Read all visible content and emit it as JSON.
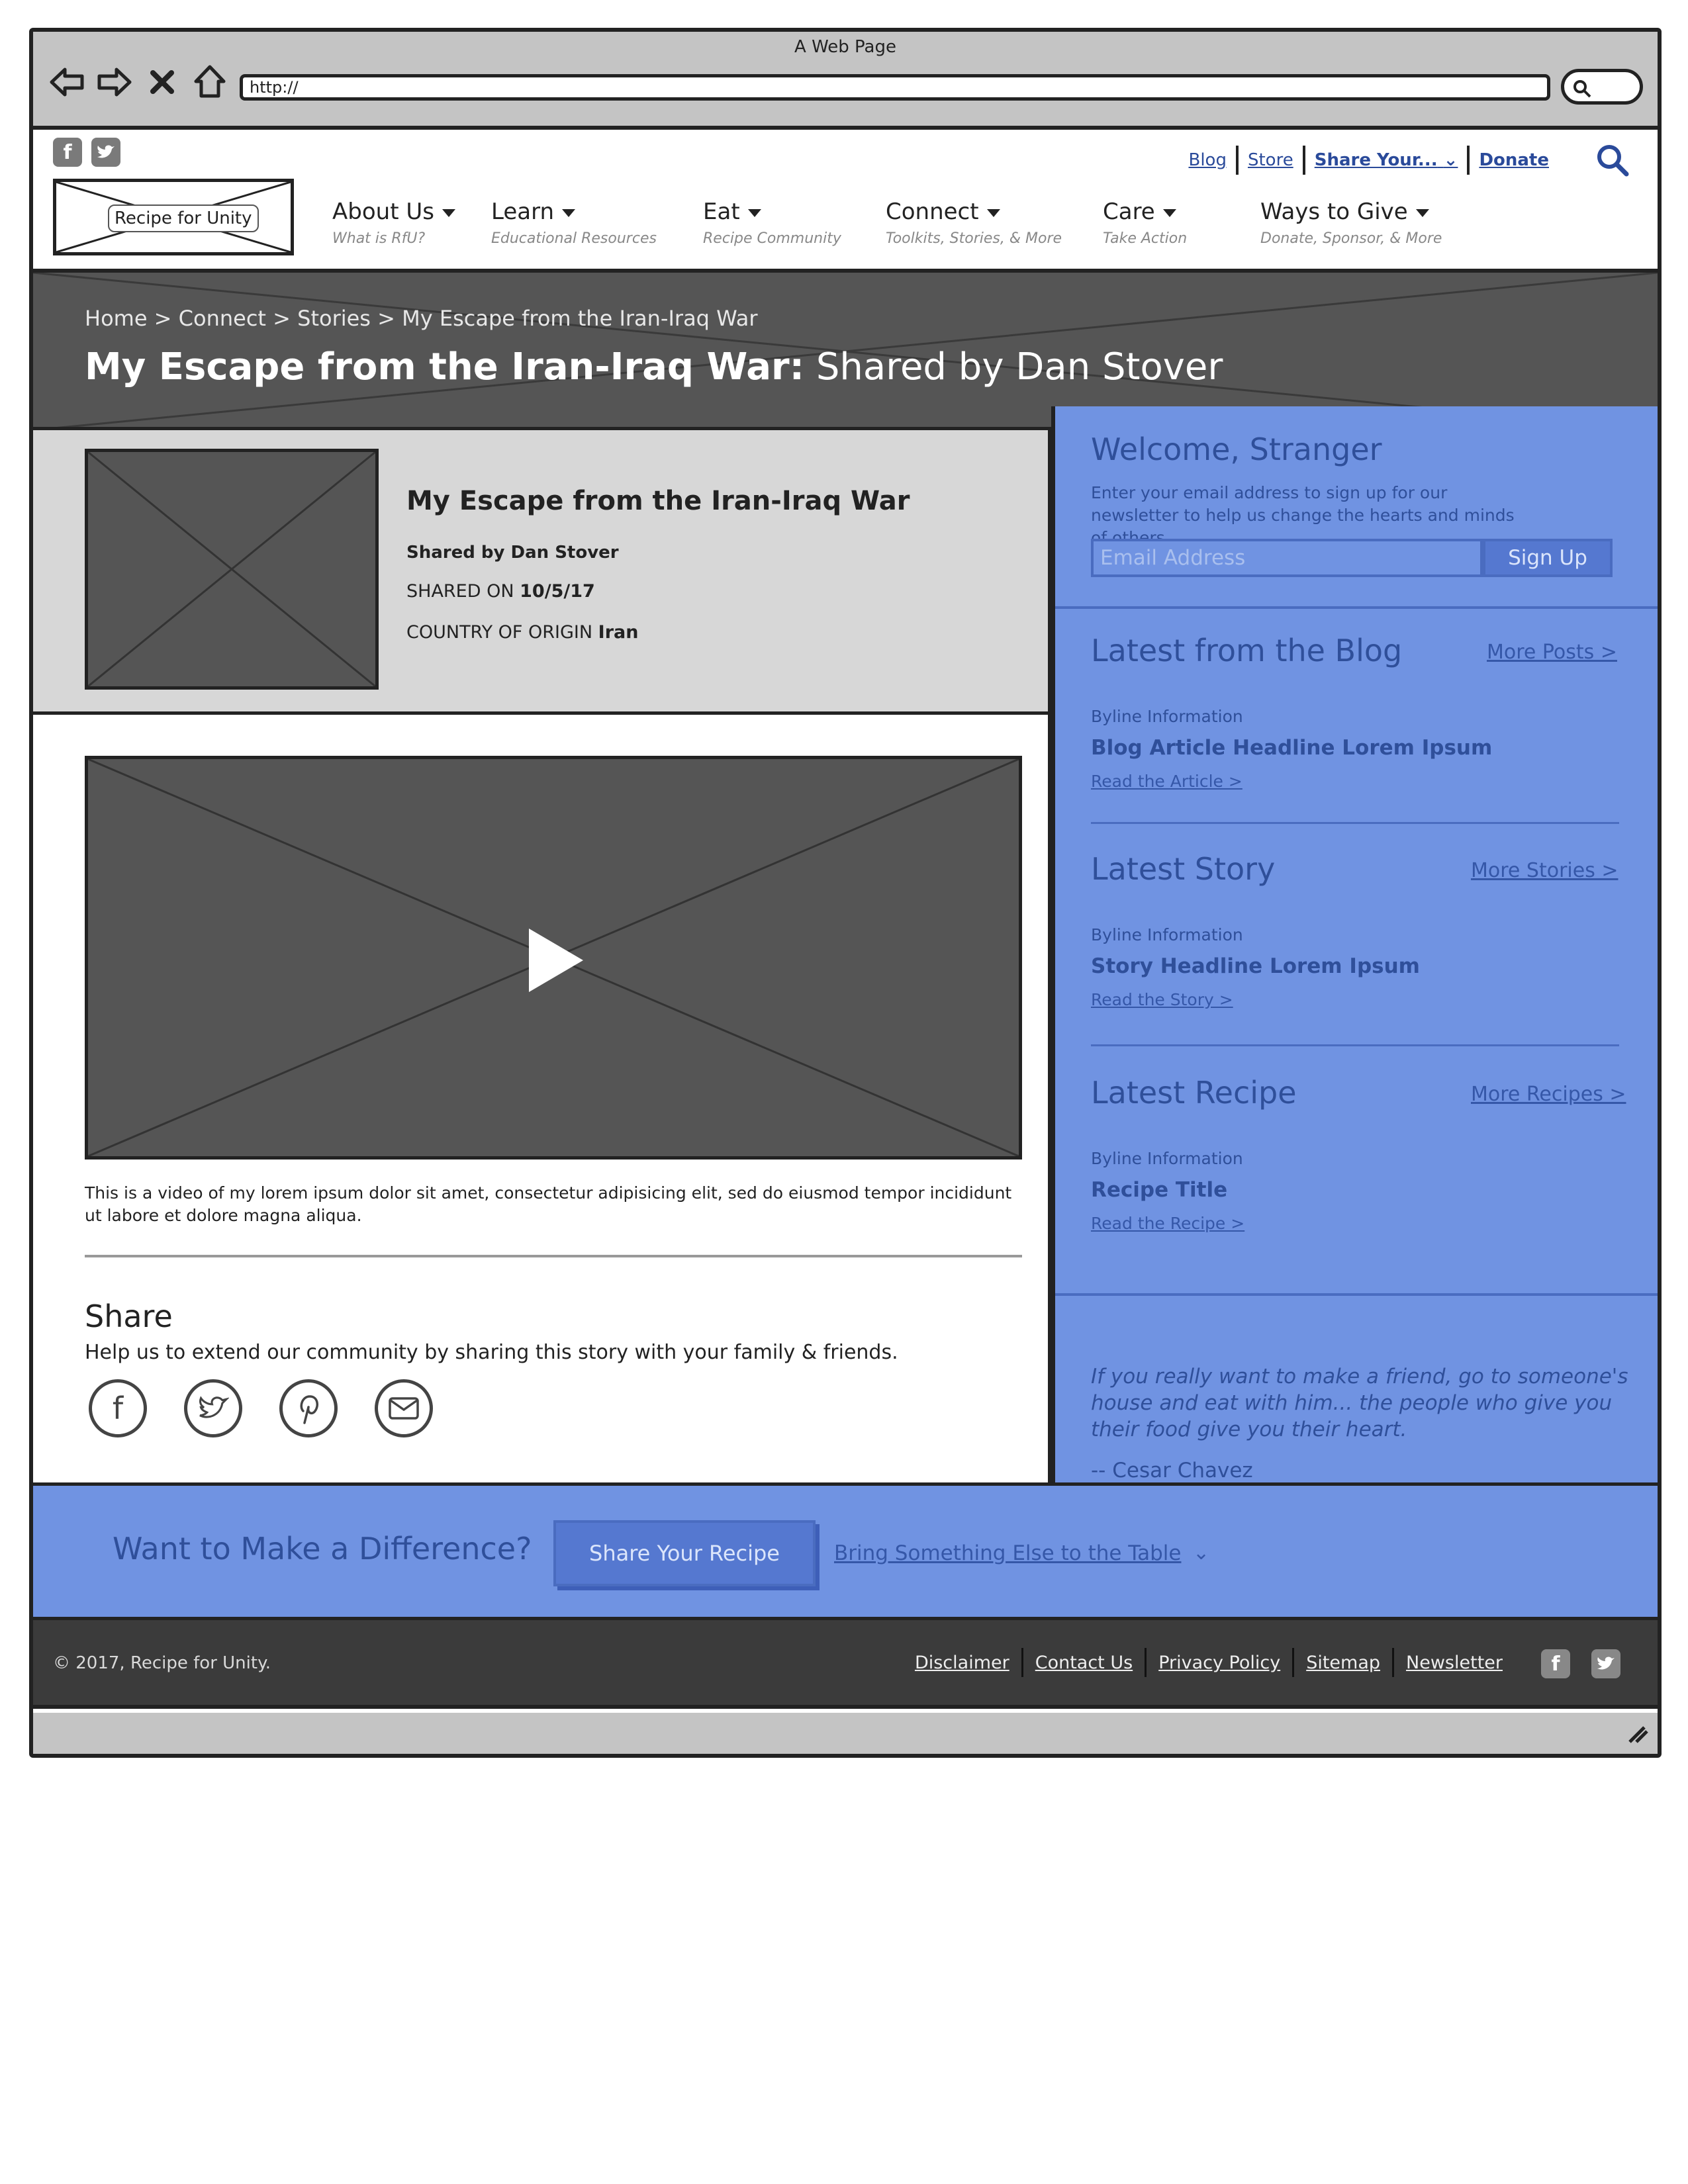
{
  "browser": {
    "window_title": "A Web Page",
    "url": "http://"
  },
  "header": {
    "logo_text": "Recipe for Unity",
    "social": [
      "facebook-icon",
      "twitter-icon"
    ],
    "utility_links": {
      "blog": "Blog",
      "store": "Store",
      "share": "Share Your...",
      "donate": "Donate"
    },
    "nav": [
      {
        "label": "About Us",
        "sub": "What is RfU?"
      },
      {
        "label": "Learn",
        "sub": "Educational Resources"
      },
      {
        "label": "Eat",
        "sub": "Recipe Community"
      },
      {
        "label": "Connect",
        "sub": "Toolkits, Stories, & More"
      },
      {
        "label": "Care",
        "sub": "Take Action"
      },
      {
        "label": "Ways to Give",
        "sub": "Donate, Sponsor, & More"
      }
    ],
    "active_nav": "Connect"
  },
  "hero": {
    "breadcrumb": "Home > Connect > Stories > My Escape from the Iran-Iraq War",
    "title_bold": "My Escape from the Iran-Iraq War:",
    "title_rest": " Shared by Dan Stover"
  },
  "story": {
    "title": "My Escape from the Iran-Iraq War",
    "shared_by": "Shared by Dan Stover",
    "shared_on_label": "SHARED ON ",
    "shared_on_value": "10/5/17",
    "country_label": "COUNTRY OF ORIGIN ",
    "country_value": "Iran",
    "caption": "This is a video of my lorem ipsum dolor sit amet, consectetur adipisicing elit, sed do eiusmod tempor incididunt ut labore et dolore magna aliqua."
  },
  "share": {
    "heading": "Share",
    "text": "Help us to extend our community by sharing this story with your family & friends.",
    "icons": [
      "facebook-icon",
      "twitter-icon",
      "pinterest-icon",
      "email-icon"
    ]
  },
  "sidebar": {
    "welcome": {
      "heading": "Welcome, Stranger",
      "text": "Enter your email address to sign up for our newsletter to help us change the hearts and minds of others.",
      "email_placeholder": "Email Address",
      "signup_label": "Sign Up"
    },
    "blog": {
      "heading": "Latest from the Blog",
      "more": "More Posts >",
      "byline": "Byline Information",
      "headline": "Blog Article Headline Lorem Ipsum",
      "link": "Read the Article >"
    },
    "story": {
      "heading": "Latest Story",
      "more": "More Stories >",
      "byline": "Byline Information",
      "headline": "Story Headline Lorem Ipsum",
      "link": "Read the Story >"
    },
    "recipe": {
      "heading": "Latest Recipe",
      "more": "More Recipes >",
      "byline": "Byline Information",
      "headline": "Recipe Title",
      "link": "Read the Recipe >"
    },
    "quote": {
      "text": "If you really want to make a friend, go to someone's house and eat with him... the people who give you their food give you their heart.",
      "author": "-- Cesar Chavez"
    }
  },
  "cta": {
    "heading": "Want to Make a Difference?",
    "button": "Share Your Recipe",
    "link": "Bring Something Else to the Table"
  },
  "footer": {
    "copyright": "© 2017, Recipe for Unity.",
    "links": [
      "Disclaimer",
      "Contact Us",
      "Privacy Policy",
      "Sitemap",
      "Newsletter"
    ],
    "social": [
      "facebook-icon",
      "twitter-icon"
    ]
  },
  "colors": {
    "accent_blue": "#7093e2",
    "dark_band": "#555555",
    "footer": "#3b3b3b",
    "link_blue": "#2a4a9a"
  }
}
